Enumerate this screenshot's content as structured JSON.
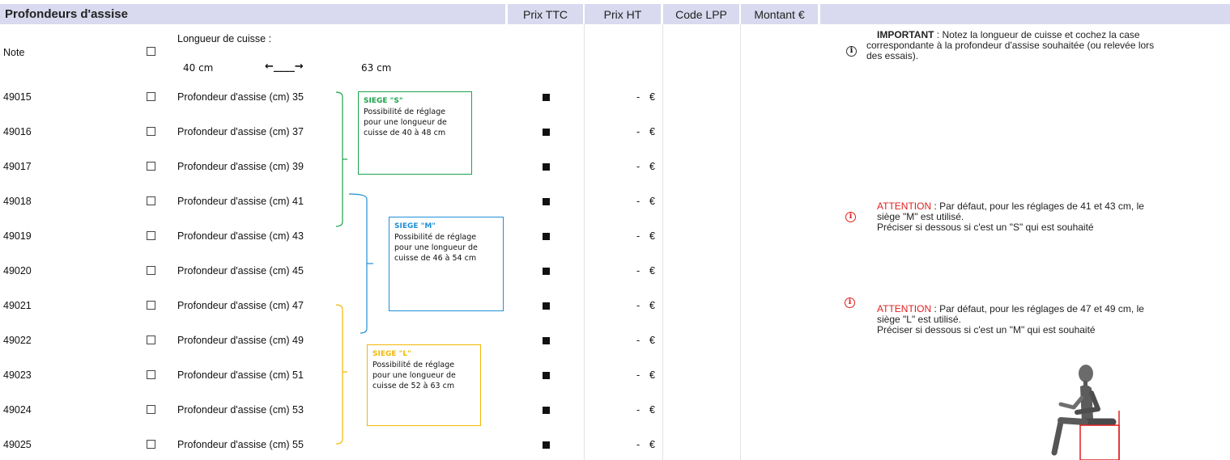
{
  "header": {
    "title": "Profondeurs d'assise",
    "prix_ttc": "Prix TTC",
    "prix_ht": "Prix HT",
    "code_lpp": "Code LPP",
    "montant": "Montant €"
  },
  "note_row": {
    "label": "Note",
    "cuisse_label": "Longueur de cuisse :",
    "min": "40 cm",
    "arrow": "←____→",
    "max": "63 cm"
  },
  "rows": [
    {
      "code": "49015",
      "desc": "Profondeur d'assise (cm) 35",
      "price": "-",
      "currency": "€"
    },
    {
      "code": "49016",
      "desc": "Profondeur d'assise (cm) 37",
      "price": "-",
      "currency": "€"
    },
    {
      "code": "49017",
      "desc": "Profondeur d'assise (cm) 39",
      "price": "-",
      "currency": "€"
    },
    {
      "code": "49018",
      "desc": "Profondeur d'assise (cm) 41",
      "price": "-",
      "currency": "€"
    },
    {
      "code": "49019",
      "desc": "Profondeur d'assise (cm) 43",
      "price": "-",
      "currency": "€"
    },
    {
      "code": "49020",
      "desc": "Profondeur d'assise (cm) 45",
      "price": "-",
      "currency": "€"
    },
    {
      "code": "49021",
      "desc": "Profondeur d'assise (cm) 47",
      "price": "-",
      "currency": "€"
    },
    {
      "code": "49022",
      "desc": "Profondeur d'assise (cm) 49",
      "price": "-",
      "currency": "€"
    },
    {
      "code": "49023",
      "desc": "Profondeur d'assise (cm) 51",
      "price": "-",
      "currency": "€"
    },
    {
      "code": "49024",
      "desc": "Profondeur d'assise (cm) 53",
      "price": "-",
      "currency": "€"
    },
    {
      "code": "49025",
      "desc": "Profondeur d'assise (cm) 55",
      "price": "-",
      "currency": "€"
    }
  ],
  "siege_s": {
    "title": "SIEGE \"S\"",
    "l1": "Possibilité de réglage",
    "l2": "pour une longueur de",
    "l3": "cuisse de 40 à 48 cm",
    "color": "#1aa34a"
  },
  "siege_m": {
    "title": "SIEGE \"M\"",
    "l1": "Possibilité de réglage",
    "l2": "pour une longueur de",
    "l3": "cuisse de 46 à 54 cm",
    "color": "#1f8fd6"
  },
  "siege_l": {
    "title": "SIEGE \"L\"",
    "l1": "Possibilité de réglage",
    "l2": "pour une longueur de",
    "l3": "cuisse de 52 à 63 cm",
    "color": "#f2b705"
  },
  "notes": {
    "important_bold": "IMPORTANT",
    "important_l1": " : Notez la longueur de cuisse et cochez la case",
    "important_l2": "correspondante à la profondeur d'assise souhaitée (ou relevée lors",
    "important_l3": "des essais).",
    "att1_red": "ATTENTION",
    "att1_l1": " : Par défaut, pour les réglages de 41 et 43 cm, le",
    "att1_l2": "siège \"M\" est utilisé.",
    "att1_l3": "Préciser si dessous si c'est un \"S\" qui est souhaité",
    "att2_red": "ATTENTION",
    "att2_l1": " : Par défaut, pour les réglages de 47 et 49 cm, le",
    "att2_l2": "siège \"L\" est utilisé.",
    "att2_l3": "Préciser si dessous si c'est un \"M\" qui est souhaité"
  },
  "icons": {
    "info": "info-icon",
    "figure": "seated-mannequin-icon"
  }
}
